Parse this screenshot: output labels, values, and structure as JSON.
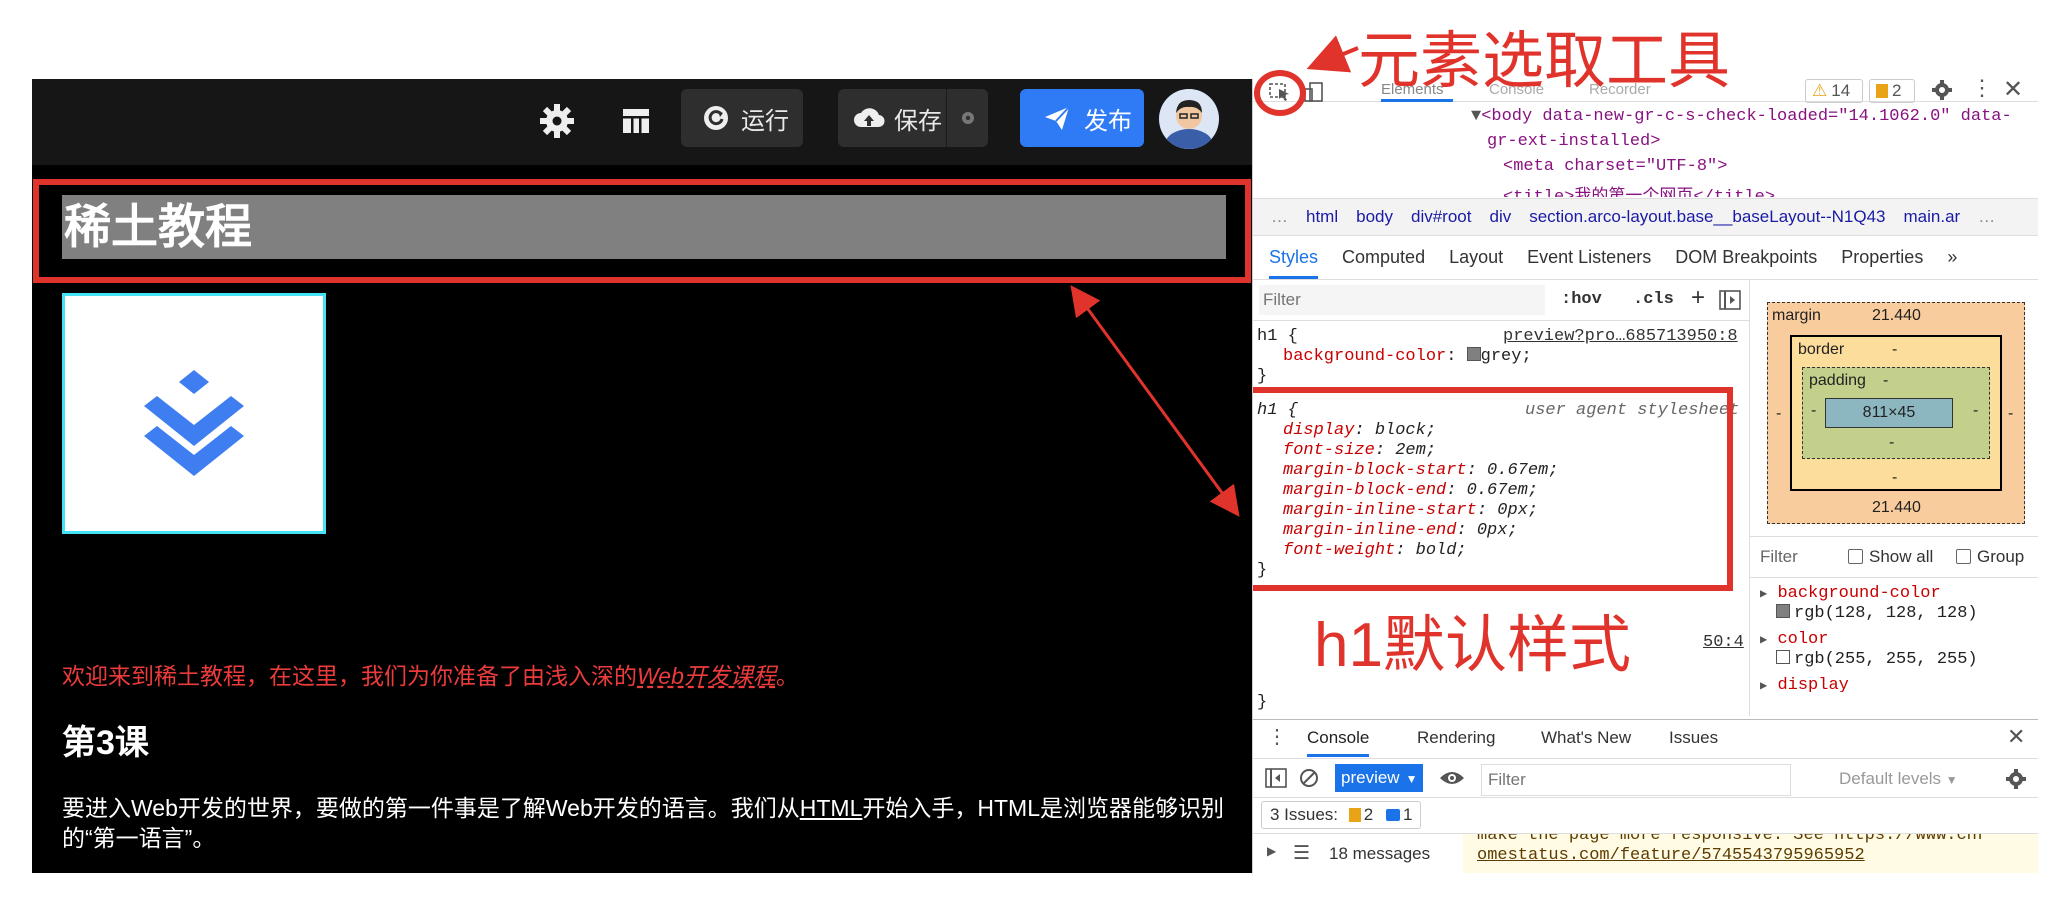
{
  "toolbar": {
    "run_label": "运行",
    "save_label": "保存",
    "publish_label": "发布"
  },
  "preview": {
    "h1_text": "稀土教程",
    "intro_prefix": "欢迎来到稀土教程，在这里，我们为你准备了由浅入深的",
    "intro_link": "Web开发课程",
    "intro_suffix": "。",
    "lesson_title": "第3课",
    "para_part1": "要进入Web开发的世界，要做的第一件事是了解Web开发的语言。我们从",
    "para_link": "HTML",
    "para_part2": "开始入手，HTML是浏览器能够识别的“第一语言”。"
  },
  "devtools": {
    "tabs": [
      "Elements",
      "Console",
      "Recorder"
    ],
    "warn_count": "14",
    "issue_count": "2",
    "dom_line1": "<body data-new-gr-c-s-check-loaded=\"14.1062.0\" data-",
    "dom_line2": "gr-ext-installed>",
    "dom_line3": "<meta charset=\"UTF-8\">",
    "dom_line4": "<title>我的第一个网页</title>",
    "breadcrumb": [
      "…",
      "html",
      "body",
      "div#root",
      "div",
      "section.arco-layout.base__baseLayout--N1Q43",
      "main.ar",
      "…"
    ],
    "subtabs": [
      "Styles",
      "Computed",
      "Layout",
      "Event Listeners",
      "DOM Breakpoints",
      "Properties",
      "»"
    ],
    "filter_placeholder": "Filter",
    "hov_label": ":hov",
    "cls_label": ".cls",
    "rule1": {
      "selector": "h1 {",
      "source": "preview?pro…685713950:8",
      "prop": "background-color",
      "value": "grey;",
      "close": "}"
    },
    "rule2": {
      "selector": "h1 {",
      "source": "user agent stylesheet",
      "props": [
        {
          "name": "display",
          "value": "block;"
        },
        {
          "name": "font-size",
          "value": "2em;"
        },
        {
          "name": "margin-block-start",
          "value": "0.67em;"
        },
        {
          "name": "margin-block-end",
          "value": "0.67em;"
        },
        {
          "name": "margin-inline-start",
          "value": "0px;"
        },
        {
          "name": "margin-inline-end",
          "value": "0px;"
        },
        {
          "name": "font-weight",
          "value": "bold;"
        }
      ],
      "close": "}"
    },
    "rule3_source_tail": "50:4",
    "rule3_close": "}",
    "box_model": {
      "margin_label": "margin",
      "margin_top": "21.440",
      "margin_bottom": "21.440",
      "margin_side": "-",
      "border_label": "border",
      "border_val": "-",
      "padding_label": "padding",
      "padding_val": "-",
      "content_size": "811×45"
    },
    "computed_filter": "Filter",
    "show_all": "Show all",
    "group": "Group",
    "computed": [
      {
        "name": "background-color",
        "value": "rgb(128, 128, 128)",
        "swatch": "#808080"
      },
      {
        "name": "color",
        "value": "rgb(255, 255, 255)",
        "swatch": "#ffffff"
      },
      {
        "name": "display",
        "value": "block"
      }
    ],
    "drawer_tabs": [
      "Console",
      "Rendering",
      "What's New",
      "Issues"
    ],
    "context": "preview",
    "console_filter": "Filter",
    "default_levels": "Default levels",
    "issues_summary": "3 Issues:",
    "issues_warn": "2",
    "issues_info": "1",
    "messages_count": "18 messages",
    "msg_line1": "make the page more responsive. See https://www.chr",
    "msg_line2": "omestatus.com/feature/5745543795965952"
  },
  "annotations": {
    "tool_label": "元素选取工具",
    "h1_label": "h1默认样式"
  },
  "colors": {
    "accent_red": "#e0332b",
    "publish_blue": "#2f7bf5",
    "h1_bg": "#808080"
  }
}
